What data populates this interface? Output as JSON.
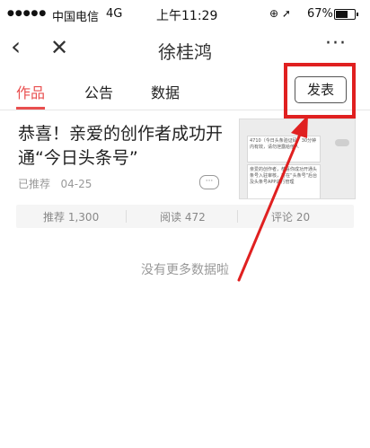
{
  "status_bar": {
    "signal": "●●●●●",
    "carrier": "中国电信",
    "network": "4G",
    "time": "上午11:29",
    "icons": "⊕ ➚",
    "battery_percent": "67%",
    "battery_level": 0.67
  },
  "nav": {
    "back_icon": "‹",
    "close_icon": "✕",
    "title": "徐桂鸿",
    "more_icon": "···"
  },
  "tabs": [
    {
      "label": "作品",
      "active": true
    },
    {
      "label": "公告",
      "active": false
    },
    {
      "label": "数据",
      "active": false
    }
  ],
  "publish_button": "发表",
  "article": {
    "title": "恭喜！亲爱的创作者成功开通“今日头条号”",
    "status": "已推荐",
    "date": "04-25",
    "more_icon": "···",
    "thumbnail_text_1": "4710（今日头条验证码）30分钟内有效，请勿泄露给他人",
    "thumbnail_text_2": "亲爱的创作者，恭喜你成功开通头条号入驻审核，可在“头条号”后台及头条号APP进行管理"
  },
  "stats": [
    {
      "label": "推荐",
      "value": "1,300"
    },
    {
      "label": "阅读",
      "value": "472"
    },
    {
      "label": "评论",
      "value": "20"
    }
  ],
  "footer_text": "没有更多数据啦",
  "colors": {
    "accent": "#e94f4f",
    "annotation": "#e02020"
  }
}
